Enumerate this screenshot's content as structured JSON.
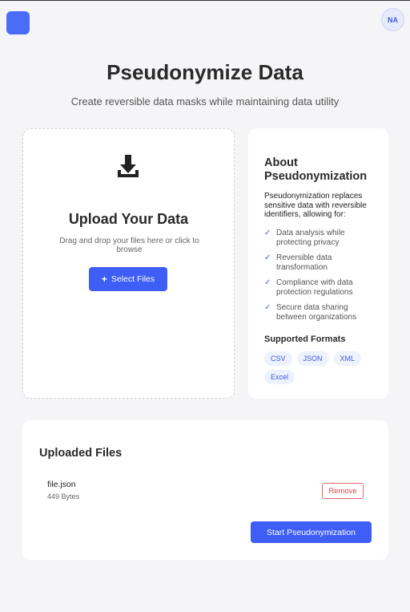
{
  "header": {
    "avatar_initials": "NA",
    "accent_color": "#4a6cf7"
  },
  "page": {
    "title": "Pseudonymize Data",
    "subtitle": "Create reversible data masks while maintaining data utility"
  },
  "upload": {
    "icon": "download-icon",
    "title": "Upload Your Data",
    "help": "Drag and drop your files here or click to browse",
    "select_button_icon": "plus-icon",
    "select_button_label": "Select Files"
  },
  "about": {
    "title": "About Pseudonymization",
    "description": "Pseudonymization replaces sensitive data with reversible identifiers, allowing for:",
    "check_icon": "check-icon",
    "benefits": [
      "Data analysis while protecting privacy",
      "Reversible data transformation",
      "Compliance with data protection regulations",
      "Secure data sharing between organizations"
    ],
    "formats_title": "Supported Formats",
    "formats": [
      "CSV",
      "JSON",
      "XML",
      "Excel"
    ]
  },
  "files": {
    "title": "Uploaded Files",
    "items": [
      {
        "name": "file.json",
        "size": "449 Bytes",
        "remove_label": "Remove"
      }
    ],
    "start_button_label": "Start Pseudonymization",
    "remove_color": "#d94848"
  }
}
